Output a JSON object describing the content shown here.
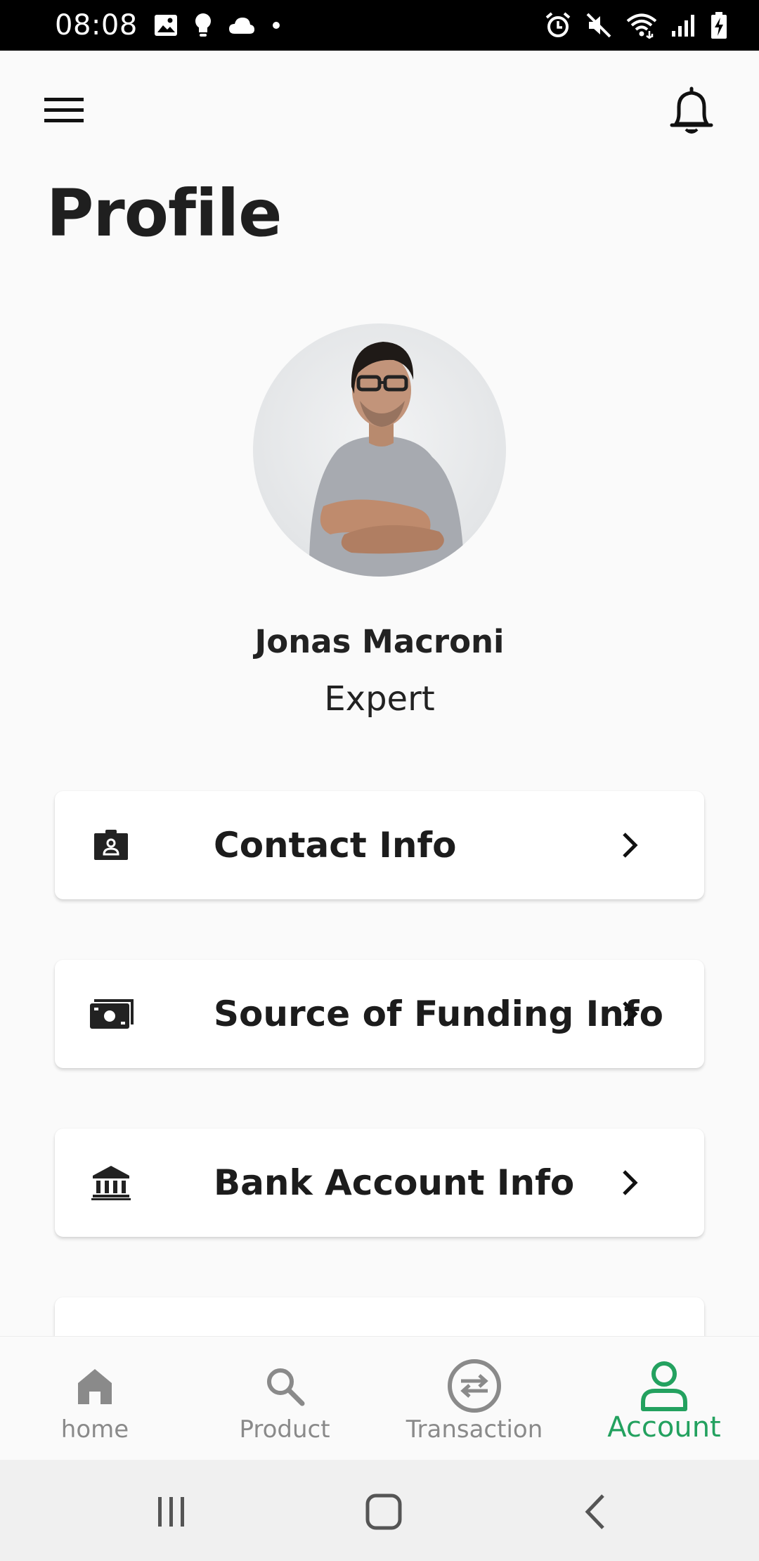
{
  "status_bar": {
    "time": "08:08",
    "left_icons": [
      "image-icon",
      "lightbulb-icon",
      "cloud-icon",
      "dot-icon"
    ],
    "right_icons": [
      "alarm-icon",
      "mute-icon",
      "wifi-icon",
      "signal-icon",
      "battery-charging-icon"
    ]
  },
  "header": {
    "menu_icon": "hamburger-menu-icon",
    "notification_icon": "bell-icon",
    "title": "Profile"
  },
  "profile": {
    "name": "Jonas Macroni",
    "role": "Expert"
  },
  "menu": [
    {
      "label": "Contact Info",
      "icon": "contact-card-icon"
    },
    {
      "label": "Source of Funding Info",
      "icon": "money-icon"
    },
    {
      "label": "Bank Account Info",
      "icon": "bank-icon"
    }
  ],
  "bottom_nav": [
    {
      "label": "home",
      "icon": "home-icon",
      "active": false
    },
    {
      "label": "Product",
      "icon": "search-icon",
      "active": false
    },
    {
      "label": "Transaction",
      "icon": "transfer-icon",
      "active": false
    },
    {
      "label": "Account",
      "icon": "account-icon",
      "active": true
    }
  ],
  "colors": {
    "accent": "#23a15f",
    "inactive": "#8a8a8a",
    "background": "#fafafa",
    "status_bar": "#000000"
  }
}
